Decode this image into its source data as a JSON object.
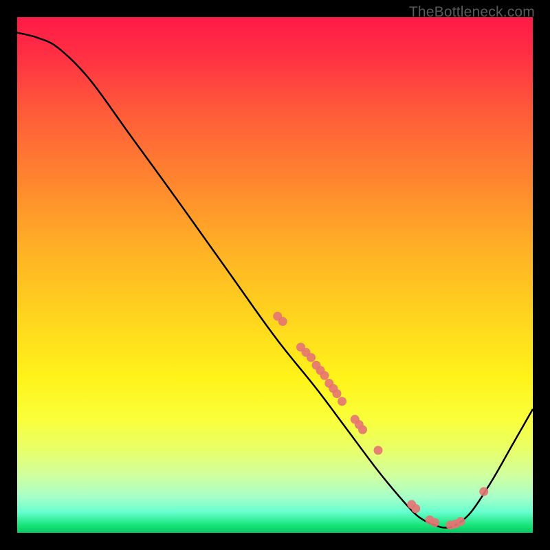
{
  "watermark": "TheBottleneck.com",
  "chart_data": {
    "type": "line",
    "title": "",
    "xlabel": "",
    "ylabel": "",
    "xlim": [
      0,
      100
    ],
    "ylim": [
      0,
      100
    ],
    "curve": [
      {
        "x": 0,
        "y": 97
      },
      {
        "x": 4,
        "y": 96
      },
      {
        "x": 8,
        "y": 94
      },
      {
        "x": 14,
        "y": 88
      },
      {
        "x": 22,
        "y": 77
      },
      {
        "x": 30,
        "y": 66
      },
      {
        "x": 40,
        "y": 52
      },
      {
        "x": 50,
        "y": 38
      },
      {
        "x": 58,
        "y": 28
      },
      {
        "x": 64,
        "y": 20
      },
      {
        "x": 70,
        "y": 12
      },
      {
        "x": 75,
        "y": 6
      },
      {
        "x": 78,
        "y": 3
      },
      {
        "x": 81,
        "y": 1.5
      },
      {
        "x": 83,
        "y": 1
      },
      {
        "x": 85,
        "y": 1.5
      },
      {
        "x": 88,
        "y": 4
      },
      {
        "x": 92,
        "y": 10
      },
      {
        "x": 96,
        "y": 17
      },
      {
        "x": 100,
        "y": 24
      }
    ],
    "points": [
      {
        "x": 50.5,
        "y": 42
      },
      {
        "x": 51.5,
        "y": 41
      },
      {
        "x": 55,
        "y": 36
      },
      {
        "x": 56,
        "y": 35
      },
      {
        "x": 57,
        "y": 34
      },
      {
        "x": 58,
        "y": 32.5
      },
      {
        "x": 58.8,
        "y": 31.5
      },
      {
        "x": 59.6,
        "y": 30.5
      },
      {
        "x": 60.5,
        "y": 29
      },
      {
        "x": 61.3,
        "y": 28
      },
      {
        "x": 62,
        "y": 27
      },
      {
        "x": 63,
        "y": 25.5
      },
      {
        "x": 65.5,
        "y": 22
      },
      {
        "x": 66.3,
        "y": 21
      },
      {
        "x": 67,
        "y": 20
      },
      {
        "x": 70,
        "y": 16
      },
      {
        "x": 76.5,
        "y": 5.5
      },
      {
        "x": 77.3,
        "y": 4.7
      },
      {
        "x": 80,
        "y": 2.5
      },
      {
        "x": 81,
        "y": 2
      },
      {
        "x": 84,
        "y": 1.5
      },
      {
        "x": 85,
        "y": 1.7
      },
      {
        "x": 86,
        "y": 2.2
      },
      {
        "x": 90.5,
        "y": 8
      }
    ],
    "point_color": "#e57373",
    "point_radius": 6.5
  }
}
